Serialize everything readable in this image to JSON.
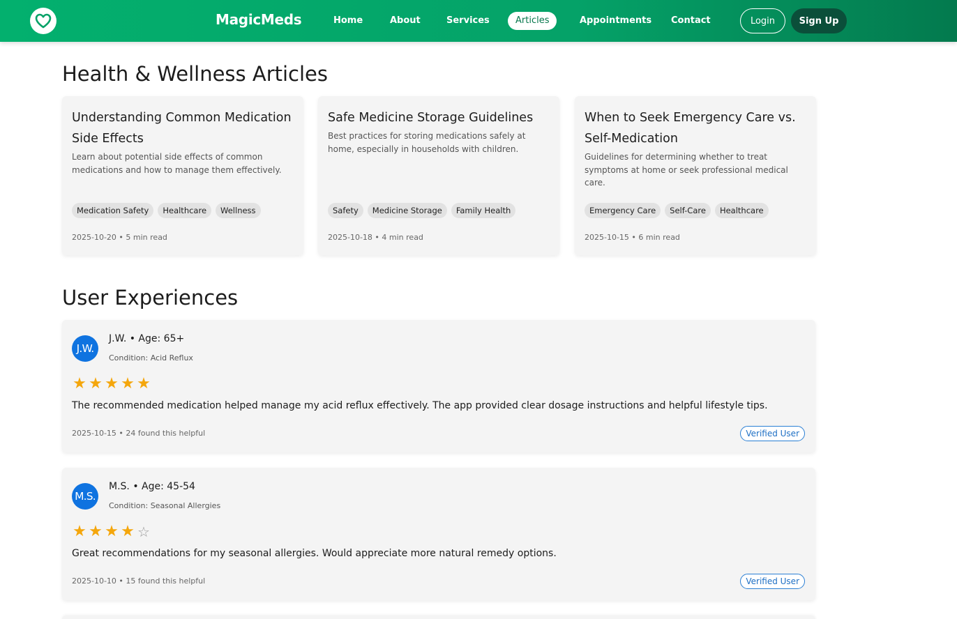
{
  "navbar": {
    "logo_icon": "heart-icon",
    "brand": "MagicMeds",
    "links": [
      "Home",
      "About",
      "Services",
      "Articles",
      "Appointments",
      "Contact"
    ],
    "active_link": "Articles",
    "login_label": "Login",
    "signup_label": "Sign Up",
    "accent_color": "#03b06e",
    "signup_color": "#0b4f3a"
  },
  "articles": {
    "heading": "Health & Wellness Articles",
    "items": [
      {
        "title": "Understanding Common Medication Side Effects",
        "description": "Learn about potential side effects of common medications and how to manage them effectively.",
        "tags": [
          "Medication Safety",
          "Healthcare",
          "Wellness"
        ],
        "meta": "2025-10-20 • 5 min read"
      },
      {
        "title": "Safe Medicine Storage Guidelines",
        "description": "Best practices for storing medications safely at home, especially in households with children.",
        "tags": [
          "Safety",
          "Medicine Storage",
          "Family Health"
        ],
        "meta": "2025-10-18 • 4 min read"
      },
      {
        "title": "When to Seek Emergency Care vs. Self-Medication",
        "description": "Guidelines for determining whether to treat symptoms at home or seek professional medical care.",
        "tags": [
          "Emergency Care",
          "Self-Care",
          "Healthcare"
        ],
        "meta": "2025-10-15 • 6 min read"
      }
    ]
  },
  "experiences": {
    "heading": "User Experiences",
    "items": [
      {
        "initials": "J.W.",
        "reviewer": "J.W. • Age: 65+",
        "condition": "Condition: Acid Reflux",
        "rating": 5,
        "max_rating": 5,
        "text": "The recommended medication helped manage my acid reflux effectively. The app provided clear dosage instructions and helpful lifestyle tips.",
        "meta": "2025-10-15 • 24 found this helpful",
        "badge": "Verified User"
      },
      {
        "initials": "M.S.",
        "reviewer": "M.S. • Age: 45-54",
        "condition": "Condition: Seasonal Allergies",
        "rating": 4,
        "max_rating": 5,
        "text": "Great recommendations for my seasonal allergies. Would appreciate more natural remedy options.",
        "meta": "2025-10-10 • 15 found this helpful",
        "badge": "Verified User"
      }
    ]
  }
}
